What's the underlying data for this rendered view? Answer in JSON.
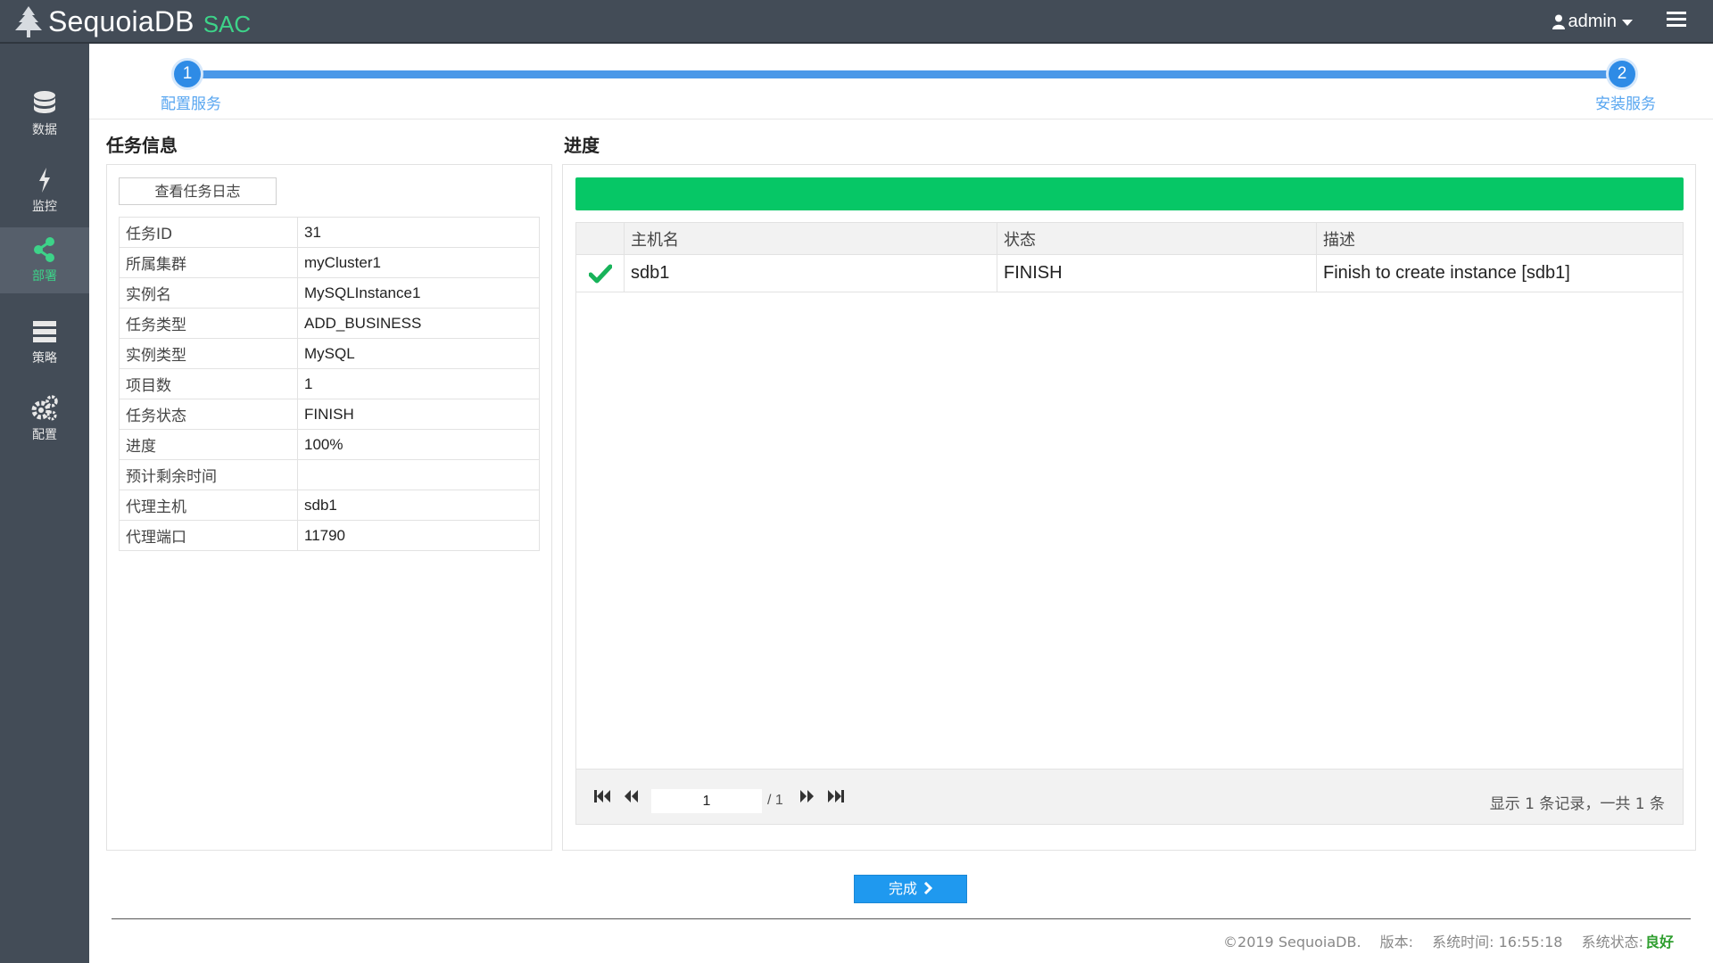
{
  "header": {
    "brand_name": "SequoiaDB",
    "brand_suffix": "SAC",
    "user": "admin"
  },
  "sidebar": {
    "items": [
      {
        "label": "数据",
        "icon": "database-icon"
      },
      {
        "label": "监控",
        "icon": "lightning-icon"
      },
      {
        "label": "部署",
        "icon": "share-icon",
        "active": true
      },
      {
        "label": "策略",
        "icon": "server-icon"
      },
      {
        "label": "配置",
        "icon": "gears-icon"
      }
    ]
  },
  "wizard": {
    "steps": [
      {
        "number": "1",
        "label": "配置服务"
      },
      {
        "number": "2",
        "label": "安装服务"
      }
    ]
  },
  "task_info": {
    "title": "任务信息",
    "view_log_button": "查看任务日志",
    "rows": [
      {
        "key": "任务ID",
        "value": "31"
      },
      {
        "key": "所属集群",
        "value": "myCluster1"
      },
      {
        "key": "实例名",
        "value": "MySQLInstance1"
      },
      {
        "key": "任务类型",
        "value": "ADD_BUSINESS"
      },
      {
        "key": "实例类型",
        "value": "MySQL"
      },
      {
        "key": "项目数",
        "value": "1"
      },
      {
        "key": "任务状态",
        "value": "FINISH"
      },
      {
        "key": "进度",
        "value": "100%"
      },
      {
        "key": "预计剩余时间",
        "value": ""
      },
      {
        "key": "代理主机",
        "value": "sdb1"
      },
      {
        "key": "代理端口",
        "value": "11790"
      }
    ]
  },
  "progress": {
    "title": "进度",
    "percent": 100,
    "fill_color": "#06c766",
    "columns": [
      "主机名",
      "状态",
      "描述"
    ],
    "rows": [
      {
        "host": "sdb1",
        "status": "FINISH",
        "description": "Finish to create instance [sdb1]",
        "icon": "check-icon"
      }
    ],
    "pager": {
      "current_page": "1",
      "total_pages": "/ 1",
      "summary": "显示 1 条记录，一共 1 条"
    }
  },
  "actions": {
    "finish_label": "完成"
  },
  "footer": {
    "copyright": "©2019 SequoiaDB.",
    "version_label": "版本:",
    "time_label": "系统时间: 16:55:18",
    "status_label": "系统状态:",
    "status_value": "良好",
    "status_color": "#2e9e2e"
  }
}
